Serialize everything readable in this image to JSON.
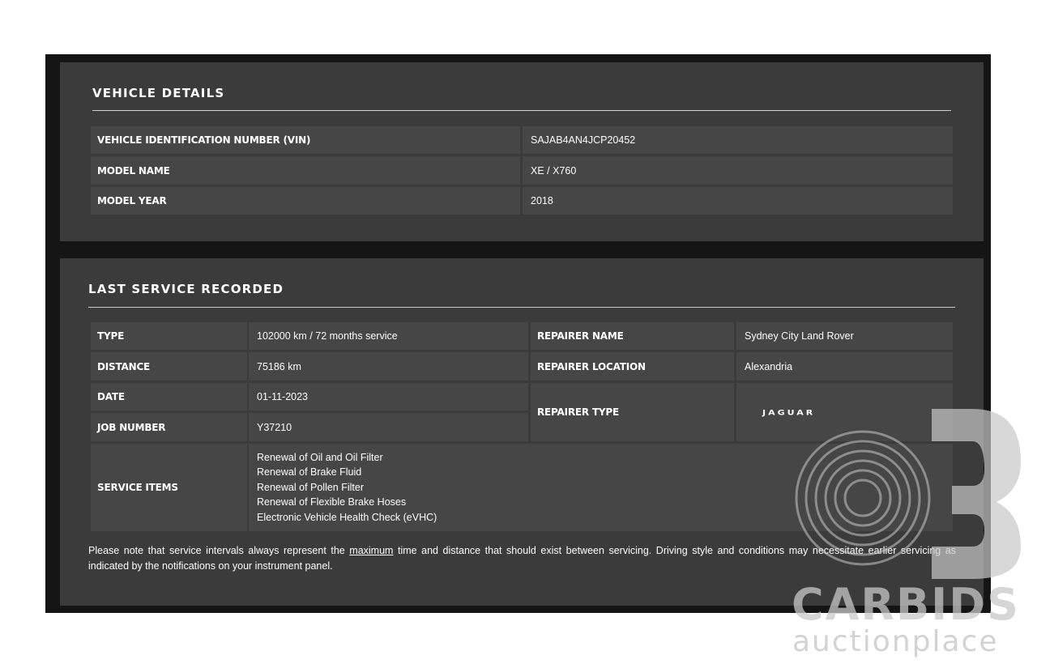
{
  "vehicle_details": {
    "title": "VEHICLE DETAILS",
    "rows": [
      {
        "label": "VEHICLE IDENTIFICATION NUMBER (VIN)",
        "value": "SAJAB4AN4JCP20452"
      },
      {
        "label": "MODEL NAME",
        "value": "XE / X760"
      },
      {
        "label": "MODEL YEAR",
        "value": "2018"
      }
    ]
  },
  "last_service": {
    "title": "LAST SERVICE RECORDED",
    "type_label": "TYPE",
    "type_value": "102000 km / 72 months service",
    "distance_label": "DISTANCE",
    "distance_value": "75186 km",
    "date_label": "DATE",
    "date_value": "01-11-2023",
    "job_label": "JOB NUMBER",
    "job_value": "Y37210",
    "repairer_name_label": "REPAIRER NAME",
    "repairer_name_value": "Sydney City Land Rover",
    "repairer_location_label": "REPAIRER LOCATION",
    "repairer_location_value": "Alexandria",
    "repairer_type_label": "REPAIRER TYPE",
    "repairer_type_logo": "JAGUAR",
    "service_items_label": "SERVICE ITEMS",
    "service_items": [
      "Renewal of Oil and Oil Filter",
      "Renewal of Brake Fluid",
      "Renewal of Pollen Filter",
      "Renewal of Flexible Brake Hoses",
      "Electronic Vehicle Health Check (eVHC)"
    ],
    "note_before": "Please note that service intervals always represent the ",
    "note_emphasis": "maximum",
    "note_after": " time and distance that should exist between servicing. Driving style and conditions may necessitate earlier servicing as indicated by the notifications on your instrument panel."
  },
  "watermark": {
    "brand": "CARBIDS",
    "tagline": "auctionplace",
    "color": "#c8c8c8"
  }
}
